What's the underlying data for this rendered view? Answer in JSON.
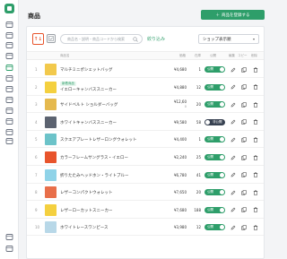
{
  "page": {
    "title": "商品"
  },
  "header": {
    "create_button_label": "商品を登録する",
    "create_button_icon": "plus-icon"
  },
  "sidebar": {
    "logo": "store-logo",
    "icons": [
      "home-icon",
      "message-icon",
      "inbox-icon",
      "tag-icon",
      "store-icon",
      "cart-icon",
      "user-icon",
      "coupon-icon",
      "chart-icon",
      "megaphone-icon",
      "edit-icon",
      "ticket-icon",
      "settings-icon",
      "logout-icon"
    ]
  },
  "toolbar": {
    "sort_label": "↑↓",
    "search_placeholder": "商品名・説明・商品コードから検索",
    "narrow_link": "絞り込み",
    "shop_select_value": "ショップ表示順"
  },
  "table": {
    "headers": [
      "",
      "商品名",
      "価格",
      "在庫",
      "公開",
      "編集",
      "コピー",
      "削除"
    ],
    "rows": [
      {
        "num": "1",
        "name": "マルチミニポシェットバッグ",
        "badge": "",
        "price": "¥4,680",
        "price_sub": "",
        "stock": "1",
        "status": "公開",
        "published": true,
        "thumb_color": "#f2c94c"
      },
      {
        "num": "2",
        "name": "イエローキャンバススニーカー",
        "badge": "新着商品",
        "price": "¥4,880",
        "price_sub": "",
        "stock": "12",
        "status": "公開",
        "published": true,
        "thumb_color": "#f4d03f"
      },
      {
        "num": "3",
        "name": "サイドベルト ショルダーバッグ",
        "badge": "",
        "price": "¥12,60",
        "price_sub": "0",
        "stock": "20",
        "status": "公開",
        "published": true,
        "thumb_color": "#e5b94e"
      },
      {
        "num": "4",
        "name": "ホワイトキャンバススニーカー",
        "badge": "",
        "price": "¥9,580",
        "price_sub": "",
        "stock": "58",
        "status": "非公開",
        "published": false,
        "thumb_color": "#5c6370"
      },
      {
        "num": "5",
        "name": "スクエアプレートレザーロングウォレット",
        "badge": "",
        "price": "¥4,400",
        "price_sub": "",
        "stock": "1",
        "status": "公開",
        "published": true,
        "thumb_color": "#6cc3c9"
      },
      {
        "num": "6",
        "name": "カラーフレームサングラス・イエロー",
        "badge": "",
        "price": "¥2,240",
        "price_sub": "",
        "stock": "25",
        "status": "公開",
        "published": true,
        "thumb_color": "#e8542c"
      },
      {
        "num": "7",
        "name": "折りたたみヘッドホン・ライトブルー",
        "badge": "",
        "price": "¥6,780",
        "price_sub": "",
        "stock": "41",
        "status": "公開",
        "published": true,
        "thumb_color": "#8fd3e8"
      },
      {
        "num": "8",
        "name": "レザーコンパクトウォレット",
        "badge": "",
        "price": "¥7,650",
        "price_sub": "",
        "stock": "20",
        "status": "公開",
        "published": true,
        "thumb_color": "#e86f4a"
      },
      {
        "num": "9",
        "name": "レザーローカットスニーカー",
        "badge": "",
        "price": "¥7,680",
        "price_sub": "",
        "stock": "188",
        "status": "公開",
        "published": true,
        "thumb_color": "#f4d03f"
      },
      {
        "num": "10",
        "name": "ホワイトレースワンピース",
        "badge": "",
        "price": "¥3,980",
        "price_sub": "",
        "stock": "12",
        "status": "公開",
        "published": true,
        "thumb_color": "#b8d8e8"
      }
    ]
  },
  "colors": {
    "accent": "#2e9e6a",
    "sort_active": "#e8542c",
    "toggle_off": "#374151"
  }
}
